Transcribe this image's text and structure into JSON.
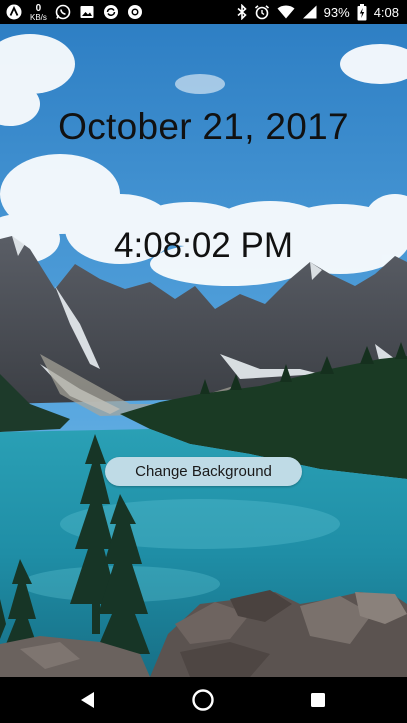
{
  "status_bar": {
    "net_speed_value": "0",
    "net_speed_unit": "KB/s",
    "battery_percent": "93%",
    "time": "4:08",
    "left_icons": [
      "app-a-icon",
      "whatsapp-icon",
      "image-icon",
      "sync-icon",
      "record-icon"
    ],
    "right_icons": [
      "bluetooth-icon",
      "alarm-icon",
      "wifi-icon",
      "signal-icon",
      "battery-charging-icon"
    ]
  },
  "clock": {
    "date": "October 21, 2017",
    "time": "4:08:02 PM"
  },
  "actions": {
    "change_background_label": "Change Background"
  },
  "nav_bar": {
    "buttons": [
      "back-icon",
      "home-icon",
      "recents-icon"
    ]
  },
  "colors": {
    "button_bg": "#bfdbe6",
    "text": "#111111"
  }
}
